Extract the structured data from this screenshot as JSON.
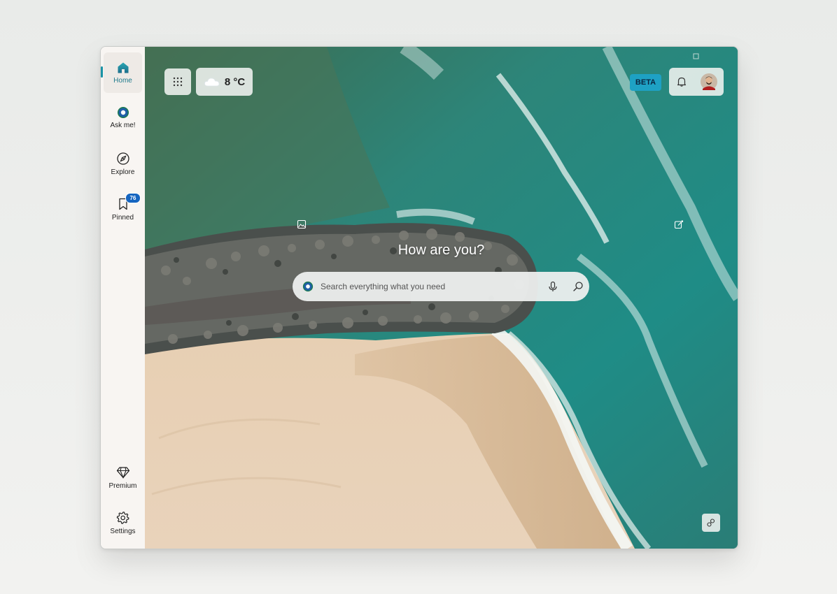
{
  "sidebar": {
    "items": [
      {
        "label": "Home",
        "icon": "home-icon"
      },
      {
        "label": "Ask me!",
        "icon": "ask-me-icon"
      },
      {
        "label": "Explore",
        "icon": "compass-icon"
      },
      {
        "label": "Pinned",
        "icon": "bookmark-icon",
        "badge": "76"
      }
    ],
    "bottom_items": [
      {
        "label": "Premium",
        "icon": "diamond-icon"
      },
      {
        "label": "Settings",
        "icon": "gear-icon"
      }
    ]
  },
  "topbar": {
    "weather": {
      "temperature": "8 °C",
      "icon": "cloud-icon"
    },
    "beta_label": "BETA"
  },
  "main": {
    "greeting": "How are you?",
    "search": {
      "placeholder": "Search everything what you need"
    }
  },
  "colors": {
    "accent": "#1a93a6",
    "badge": "#1565c0",
    "beta": "#1ea1c4"
  }
}
